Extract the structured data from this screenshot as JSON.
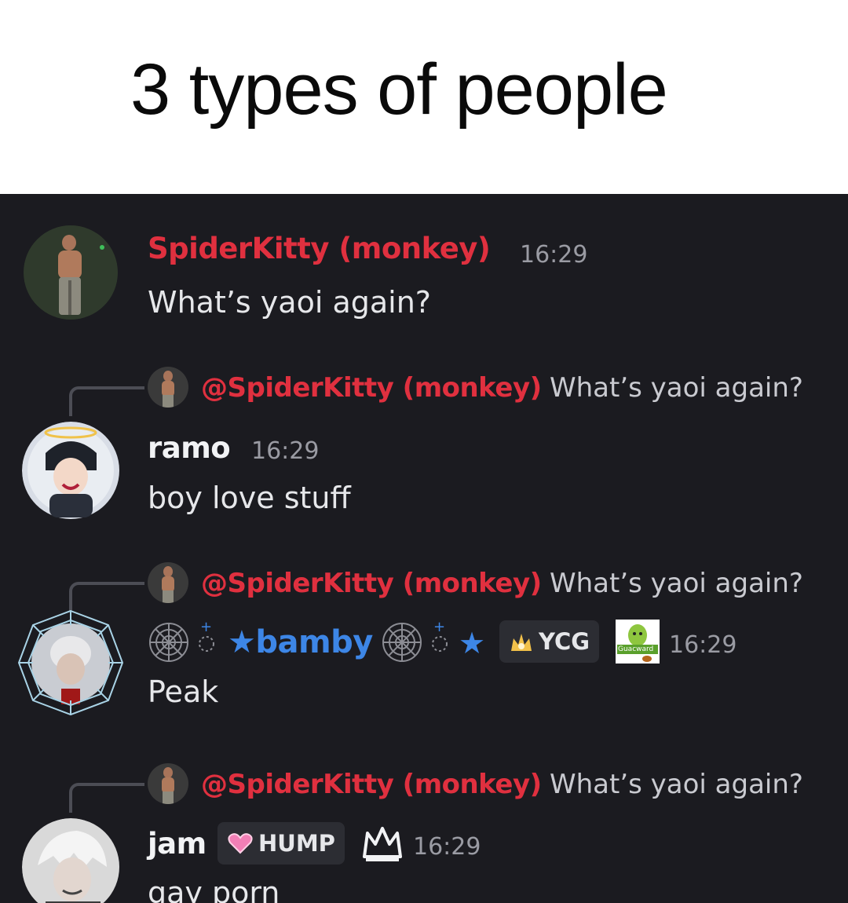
{
  "caption": "3 types of people",
  "colors": {
    "background": "#1b1b20",
    "mention_red": "#e0303f",
    "bamby_blue": "#3d86e6",
    "text": "#e6e7ea",
    "timestamp": "#9a9ba3"
  },
  "messages": [
    {
      "username": "SpiderKitty (monkey)",
      "timestamp": "16:29",
      "text": "What’s yaoi again?",
      "avatar_icon": "shirtless-man-avatar-icon"
    },
    {
      "reply": {
        "mention": "@SpiderKitty (monkey)",
        "text": "What’s yaoi again?"
      },
      "username": "ramo",
      "timestamp": "16:29",
      "text": "boy love stuff",
      "avatar_icon": "anime-boy-halo-avatar-icon"
    },
    {
      "reply": {
        "mention": "@SpiderKitty (monkey)",
        "text": "What’s yaoi again?"
      },
      "username": "★bamby",
      "username_star": "★",
      "timestamp": "16:29",
      "text": "Peak",
      "tag": {
        "label": "YCG",
        "icon": "flame-crown-icon"
      },
      "badge_icon": "guacward-avocado-icon",
      "badge_text": "Guacward",
      "avatar_icon": "spiderweb-frame-avatar-icon"
    },
    {
      "reply": {
        "mention": "@SpiderKitty (monkey)",
        "text": "What’s yaoi again?"
      },
      "username": "jam",
      "timestamp": "16:29",
      "text": "gay porn",
      "tag": {
        "label": "HUMP",
        "icon": "pink-heart-icon"
      },
      "badge_icon": "crown-icon",
      "avatar_icon": "white-hair-anime-avatar-icon"
    }
  ]
}
